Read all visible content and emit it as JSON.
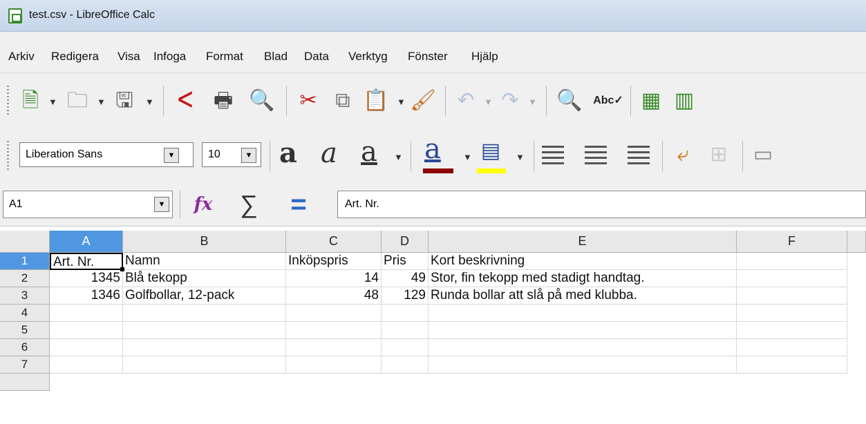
{
  "window": {
    "title": "test.csv - LibreOffice Calc"
  },
  "menu": [
    "Arkiv",
    "Redigera",
    "Visa",
    "Infoga",
    "Format",
    "Blad",
    "Data",
    "Verktyg",
    "Fönster",
    "Hjälp"
  ],
  "formatting": {
    "font_name": "Liberation Sans",
    "font_size": "10",
    "font_color": "#8b0000",
    "highlight_color": "#ffff00"
  },
  "formula_bar": {
    "name_box": "A1",
    "formula": "Art. Nr."
  },
  "sheet": {
    "columns": [
      "A",
      "B",
      "C",
      "D",
      "E",
      "F"
    ],
    "rows": [
      "1",
      "2",
      "3",
      "4",
      "5",
      "6",
      "7"
    ],
    "cells": [
      [
        "Art. Nr.",
        "Namn",
        "Inköpspris",
        "Pris",
        "Kort beskrivning",
        ""
      ],
      [
        "1345",
        "Blå tekopp",
        "14",
        "49",
        "Stor, fin tekopp med stadigt handtag.",
        ""
      ],
      [
        "1346",
        "Golfbollar, 12-pack",
        "48",
        "129",
        "Runda bollar att slå på med klubba.",
        ""
      ]
    ],
    "selected_cell": "A1",
    "selection_color": "#4f97e0"
  }
}
